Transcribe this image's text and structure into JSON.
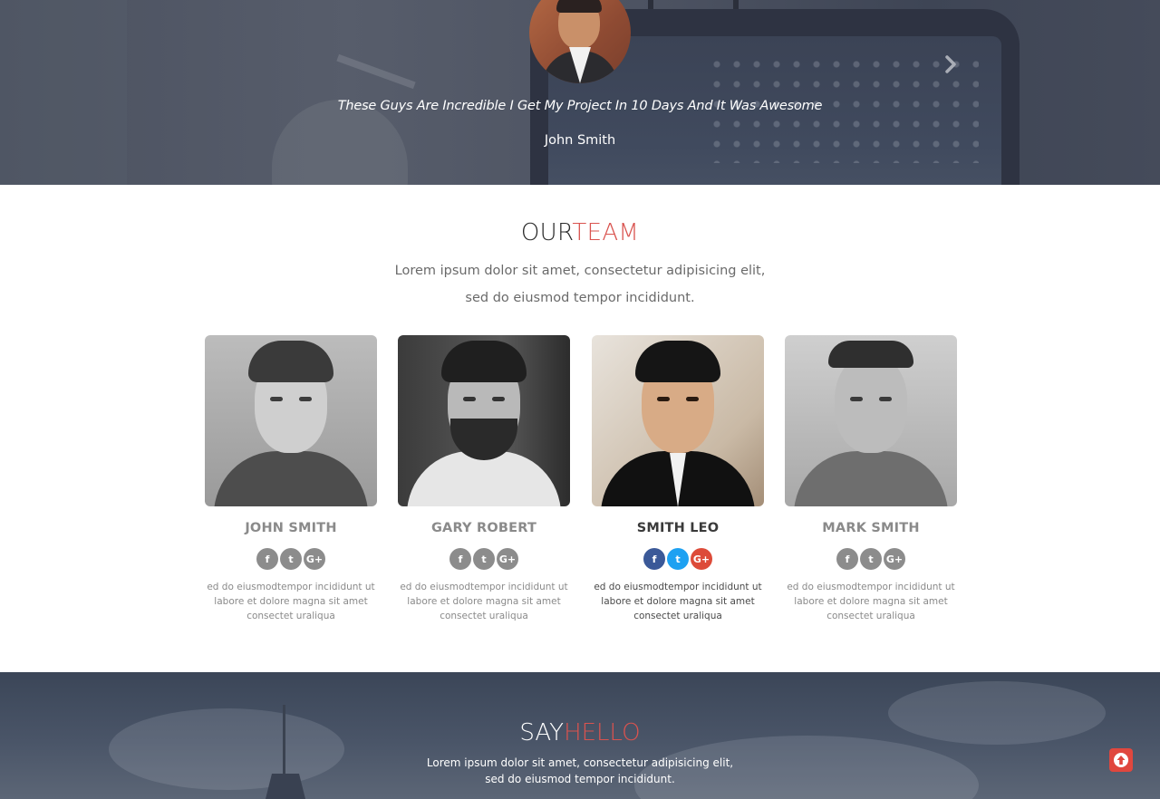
{
  "testimonial": {
    "quote": "These Guys Are Incredible I Get My Project In 10 Days And It Was Awesome",
    "author": "John Smith",
    "next_icon": "chevron-right-icon"
  },
  "team": {
    "title_main": "OUR",
    "title_accent": "TEAM",
    "subtitle_line1": "Lorem ipsum dolor sit amet, consectetur adipisicing elit,",
    "subtitle_line2": "sed do eiusmod tempor incididunt.",
    "members": [
      {
        "name": "JOHN SMITH",
        "description": "ed do eiusmodtempor incididunt ut labore et dolore magna sit amet consectet uraliqua"
      },
      {
        "name": "GARY ROBERT",
        "description": "ed do eiusmodtempor incididunt ut labore et dolore magna sit amet consectet uraliqua"
      },
      {
        "name": "SMITH LEO",
        "description": "ed do eiusmodtempor incididunt ut labore et dolore magna sit amet consectet uraliqua"
      },
      {
        "name": "MARK SMITH",
        "description": "ed do eiusmodtempor incididunt ut labore et dolore magna sit amet consectet uraliqua"
      }
    ],
    "social_glyphs": {
      "facebook": "f",
      "twitter": "t",
      "google_plus": "G+"
    }
  },
  "hello": {
    "title_main": "SAY",
    "title_accent": "HELLO",
    "subtitle_line1": "Lorem ipsum dolor sit amet, consectetur adipisicing elit,",
    "subtitle_line2": "sed do eiusmod tempor incididunt."
  },
  "colors": {
    "accent": "#d9534f",
    "facebook": "#3b5998",
    "twitter": "#1da1f2",
    "google_plus": "#dd4b39",
    "scroll_top": "#e0473e"
  }
}
